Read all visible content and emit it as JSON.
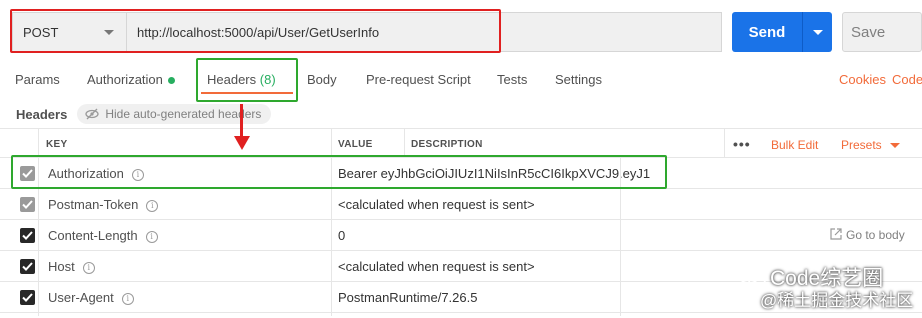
{
  "request": {
    "method": "POST",
    "url": "http://localhost:5000/api/User/GetUserInfo",
    "send_label": "Send",
    "save_label": "Save"
  },
  "tabs": [
    {
      "label": "Params"
    },
    {
      "label": "Authorization"
    },
    {
      "label": "Headers",
      "count": "(8)"
    },
    {
      "label": "Body"
    },
    {
      "label": "Pre-request Script"
    },
    {
      "label": "Tests"
    },
    {
      "label": "Settings"
    }
  ],
  "links": {
    "cookies": "Cookies",
    "code": "Code"
  },
  "headers_section": {
    "title": "Headers",
    "hide_auto": "Hide auto-generated headers"
  },
  "table": {
    "columns": {
      "key": "KEY",
      "value": "VALUE",
      "description": "DESCRIPTION"
    },
    "more": "•••",
    "bulk_edit": "Bulk Edit",
    "presets": "Presets",
    "rows": [
      {
        "key": "Authorization",
        "value": "Bearer eyJhbGciOiJIUzI1NiIsInR5cCI6IkpXVCJ9.eyJ1",
        "enabled": "disabled-checked"
      },
      {
        "key": "Postman-Token",
        "value": "<calculated when request is sent>",
        "enabled": "disabled-checked"
      },
      {
        "key": "Content-Length",
        "value": "0",
        "enabled": "checked",
        "action": "Go to body"
      },
      {
        "key": "Host",
        "value": "<calculated when request is sent>",
        "enabled": "checked"
      },
      {
        "key": "User-Agent",
        "value": "PostmanRuntime/7.26.5",
        "enabled": "checked"
      }
    ]
  },
  "watermark": {
    "line1": "Code综艺圈",
    "line2": "@稀土掘金技术社区"
  },
  "colors": {
    "accent": "#f26b3a",
    "send": "#1a73e8",
    "highlight_red": "#e02020",
    "highlight_green": "#2ea82e",
    "status_dot": "#27ae60"
  }
}
